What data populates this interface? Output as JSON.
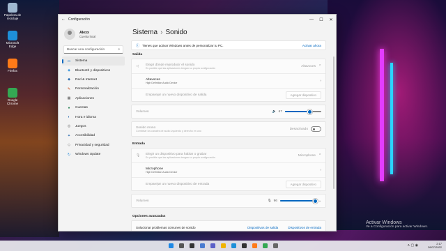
{
  "desktop": {
    "icons": [
      {
        "label": "Papelera de reciclaje",
        "color": "#9fb8d0"
      },
      {
        "label": "Microsoft Edge",
        "color": "#1e8fd8"
      },
      {
        "label": "Firefox",
        "color": "#ff7a18"
      },
      {
        "label": "Google Chrome",
        "color": "#34a853"
      }
    ],
    "activation": {
      "title": "Activar Windows",
      "subtitle": "Ve a Configuración para activar Windows."
    }
  },
  "window": {
    "title": "Configuración",
    "controls": {
      "minimize": "—",
      "maximize": "☐",
      "close": "✕"
    },
    "back_glyph": "←"
  },
  "sidebar": {
    "user_name": "Alexx",
    "user_sub": "Cuenta local",
    "search_placeholder": "Buscar una configuración",
    "items": [
      {
        "label": "Sistema",
        "icon": "▭",
        "active": true,
        "color": "#0067c0"
      },
      {
        "label": "Bluetooth y dispositivos",
        "icon": "◈",
        "color": "#0078d4"
      },
      {
        "label": "Red & Internet",
        "icon": "◆",
        "color": "#2b6cb0"
      },
      {
        "label": "Personalización",
        "icon": "✎",
        "color": "#c2410c"
      },
      {
        "label": "Aplicaciones",
        "icon": "▦",
        "color": "#555"
      },
      {
        "label": "Cuentas",
        "icon": "●",
        "color": "#2f855a"
      },
      {
        "label": "Hora e idioma",
        "icon": "◐",
        "color": "#2b6cb0"
      },
      {
        "label": "Juegos",
        "icon": "◎",
        "color": "#666"
      },
      {
        "label": "Accesibilidad",
        "icon": "✦",
        "color": "#2b6cb0"
      },
      {
        "label": "Privacidad y seguridad",
        "icon": "◇",
        "color": "#666"
      },
      {
        "label": "Windows Update",
        "icon": "↻",
        "color": "#0078d4"
      }
    ]
  },
  "main": {
    "breadcrumb_parent": "Sistema",
    "breadcrumb_sep": "›",
    "breadcrumb_current": "Sonido",
    "banner_text": "Tienes que activar Windows antes de personalizar tu PC.",
    "banner_action": "Activar ahora",
    "output": {
      "heading": "Salida",
      "choose_title": "Elegir dónde reproducir el sonido",
      "choose_sub": "Es posible que las aplicaciones tengan su propia configuración",
      "choose_value": "Altavoces",
      "device_name": "Altavoces",
      "device_sub": "High Definition Audio Device",
      "pair_label": "Emparejar un nuevo dispositivo de salida",
      "pair_button": "Agregar dispositivo",
      "volume_label": "Volumen",
      "volume_value": "67",
      "volume_level": 67,
      "mono_title": "Sonido mono",
      "mono_sub": "Combinar los canales de audio izquierdo y derecho en uno",
      "mono_state": "Desactivado"
    },
    "input": {
      "heading": "Entrada",
      "choose_title": "Elegir un dispositivo para hablar o grabar",
      "choose_sub": "Es posible que las aplicaciones tengan su propia configuración",
      "choose_value": "Microphone",
      "device_name": "Microphone",
      "device_sub": "High Definition Audio Device",
      "pair_label": "Emparejar un nuevo dispositivo de entrada",
      "pair_button": "Agregar dispositivo",
      "volume_label": "Volumen",
      "volume_value": "96",
      "volume_level": 96
    },
    "advanced": {
      "heading": "Opciones avanzadas",
      "troubleshoot": "Solucionar problemas comunes de sonido",
      "link_output": "Dispositivos de salida",
      "link_input": "Dispositivos de entrada"
    }
  },
  "taskbar": {
    "icons": [
      {
        "name": "start",
        "color": "#1e88e5"
      },
      {
        "name": "search",
        "color": "#555"
      },
      {
        "name": "task-view",
        "color": "#333"
      },
      {
        "name": "widgets",
        "color": "#4a7bd0"
      },
      {
        "name": "chat",
        "color": "#5b5fc7"
      },
      {
        "name": "explorer",
        "color": "#f0b400"
      },
      {
        "name": "edge",
        "color": "#1e8fd8"
      },
      {
        "name": "store",
        "color": "#333"
      },
      {
        "name": "firefox",
        "color": "#ff7a18"
      },
      {
        "name": "chrome",
        "color": "#34a853"
      },
      {
        "name": "settings",
        "color": "#666"
      }
    ],
    "time": "2:17",
    "date": "26/07/2022",
    "tray_glyphs": "∧  ▢  ◉"
  }
}
